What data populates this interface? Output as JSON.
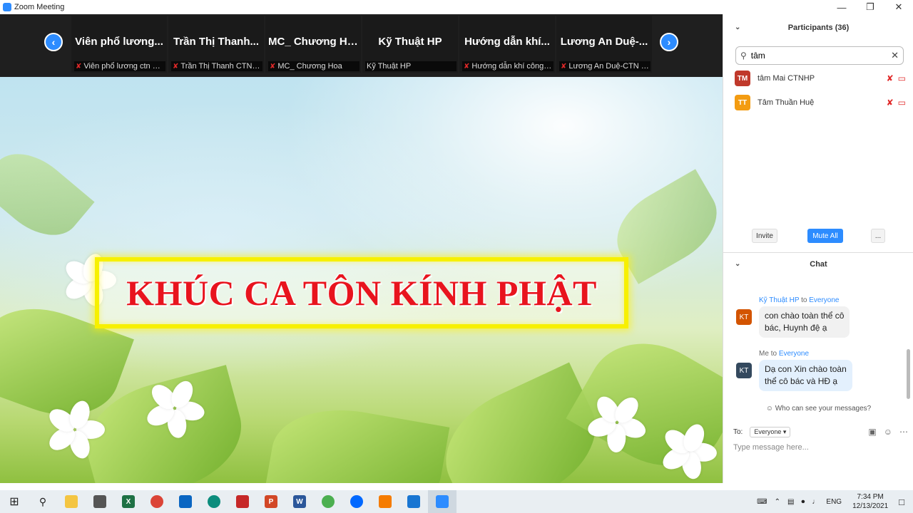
{
  "window": {
    "title": "Zoom Meeting"
  },
  "window_buttons": {
    "minimize": "—",
    "maximize": "❐",
    "close": "✕"
  },
  "gallery": {
    "prev": "‹",
    "next": "›",
    "tiles": [
      {
        "big": "Viên phổ lương...",
        "small": "Viên phổ lương ctn hà ...",
        "muted": true
      },
      {
        "big": "Trần Thị Thanh...",
        "small": "Trần Thị Thanh CTNVP",
        "muted": true
      },
      {
        "big": "MC_ Chương Hoa",
        "small": "MC_ Chương Hoa",
        "muted": true
      },
      {
        "big": "Kỹ Thuật HP",
        "small": "Kỹ Thuật HP",
        "muted": false
      },
      {
        "big": "Hướng dẫn khí...",
        "small": "Hướng dẫn khí công- ...",
        "muted": true
      },
      {
        "big": "Lương An Duệ-...",
        "small": "Lương An Duệ-CTN VP",
        "muted": true
      }
    ]
  },
  "share": {
    "banner_text": "KHÚC CA TÔN KÍNH PHẬT"
  },
  "participants": {
    "header": "Participants (36)",
    "search_value": "tâm",
    "list": [
      {
        "initials": "TM",
        "name": "tâm Mai CTNHP",
        "color": "#c0392b"
      },
      {
        "initials": "TT",
        "name": "Tâm Thuần Huệ",
        "color": "#f39c12"
      }
    ],
    "invite": "Invite",
    "mute_all": "Mute All",
    "more": "..."
  },
  "chat": {
    "header": "Chat",
    "messages": [
      {
        "sender": "Kỹ Thuật HP",
        "to_word": "to",
        "recipient": "Everyone",
        "initials": "KT",
        "avatar_color": "#d35400",
        "line1": "con chào toàn thể cô",
        "line2": "bác, Huynh đệ ạ"
      },
      {
        "sender": "Me",
        "to_word": "to",
        "recipient": "Everyone",
        "initials": "KT",
        "avatar_color": "#34495e",
        "line1": "Dạ con Xin chào toàn",
        "line2": "thể cô bác và HĐ ạ"
      }
    ],
    "who_can_see": "Who can see your messages?",
    "to_label": "To:",
    "to_value": "Everyone",
    "placeholder": "Type message here..."
  },
  "taskbar": {
    "language": "ENG",
    "time": "7:34 PM",
    "date": "12/13/2021"
  },
  "colors": {
    "accent": "#2d8cff",
    "banner_text": "#e8141e",
    "banner_border": "#f7f000"
  }
}
